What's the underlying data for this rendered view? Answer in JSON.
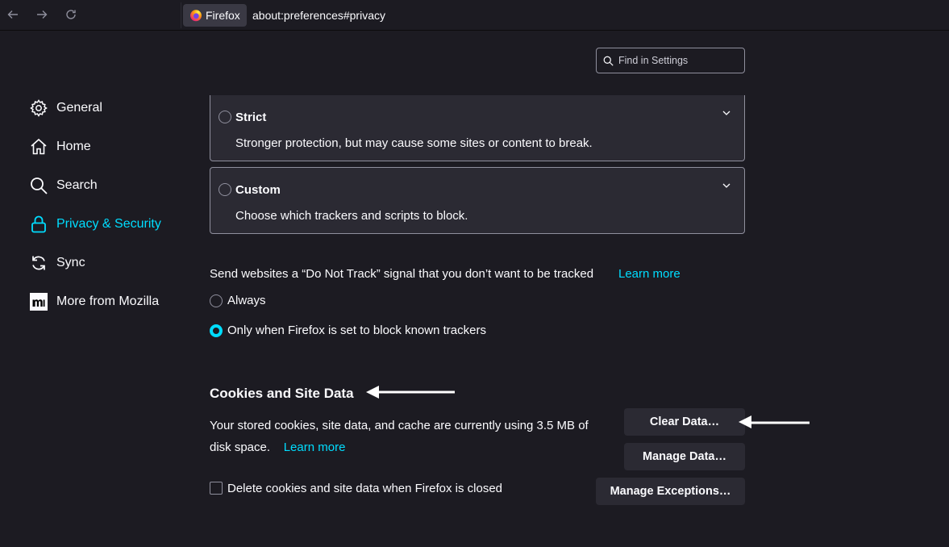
{
  "toolbar": {
    "identity_label": "Firefox",
    "url": "about:preferences#privacy",
    "icons": [
      "back-icon",
      "forward-icon",
      "reload-icon",
      "firefox-logo-icon"
    ]
  },
  "search": {
    "placeholder": "Find in Settings"
  },
  "sidebar": {
    "items": [
      {
        "label": "General",
        "icon": "gear-icon"
      },
      {
        "label": "Home",
        "icon": "home-icon"
      },
      {
        "label": "Search",
        "icon": "search-icon"
      },
      {
        "label": "Privacy & Security",
        "icon": "lock-icon",
        "active": true
      },
      {
        "label": "Sync",
        "icon": "sync-icon"
      },
      {
        "label": "More from Mozilla",
        "icon": "mozilla-icon"
      }
    ]
  },
  "tracking": {
    "strict": {
      "title": "Strict",
      "description": "Stronger protection, but may cause some sites or content to break."
    },
    "custom": {
      "title": "Custom",
      "description": "Choose which trackers and scripts to block."
    }
  },
  "dnt": {
    "text": "Send websites a “Do Not Track” signal that you don’t want to be tracked",
    "learn_more": "Learn more",
    "options": [
      {
        "label": "Always",
        "checked": false
      },
      {
        "label": "Only when Firefox is set to block known trackers",
        "checked": true
      }
    ]
  },
  "cookies": {
    "heading": "Cookies and Site Data",
    "usage_text": "Your stored cookies, site data, and cache are currently using 3.5 MB of disk space.",
    "learn_more": "Learn more",
    "clear_label": "Clear Data…",
    "manage_label": "Manage Data…",
    "exceptions_label": "Manage Exceptions…",
    "delete_on_close_label": "Delete cookies and site data when Firefox is closed",
    "delete_on_close_checked": false
  },
  "colors": {
    "accent": "#00ddff",
    "background": "#1c1b22",
    "panel": "#2b2a33",
    "annotation_arrow": "#ffffff"
  }
}
